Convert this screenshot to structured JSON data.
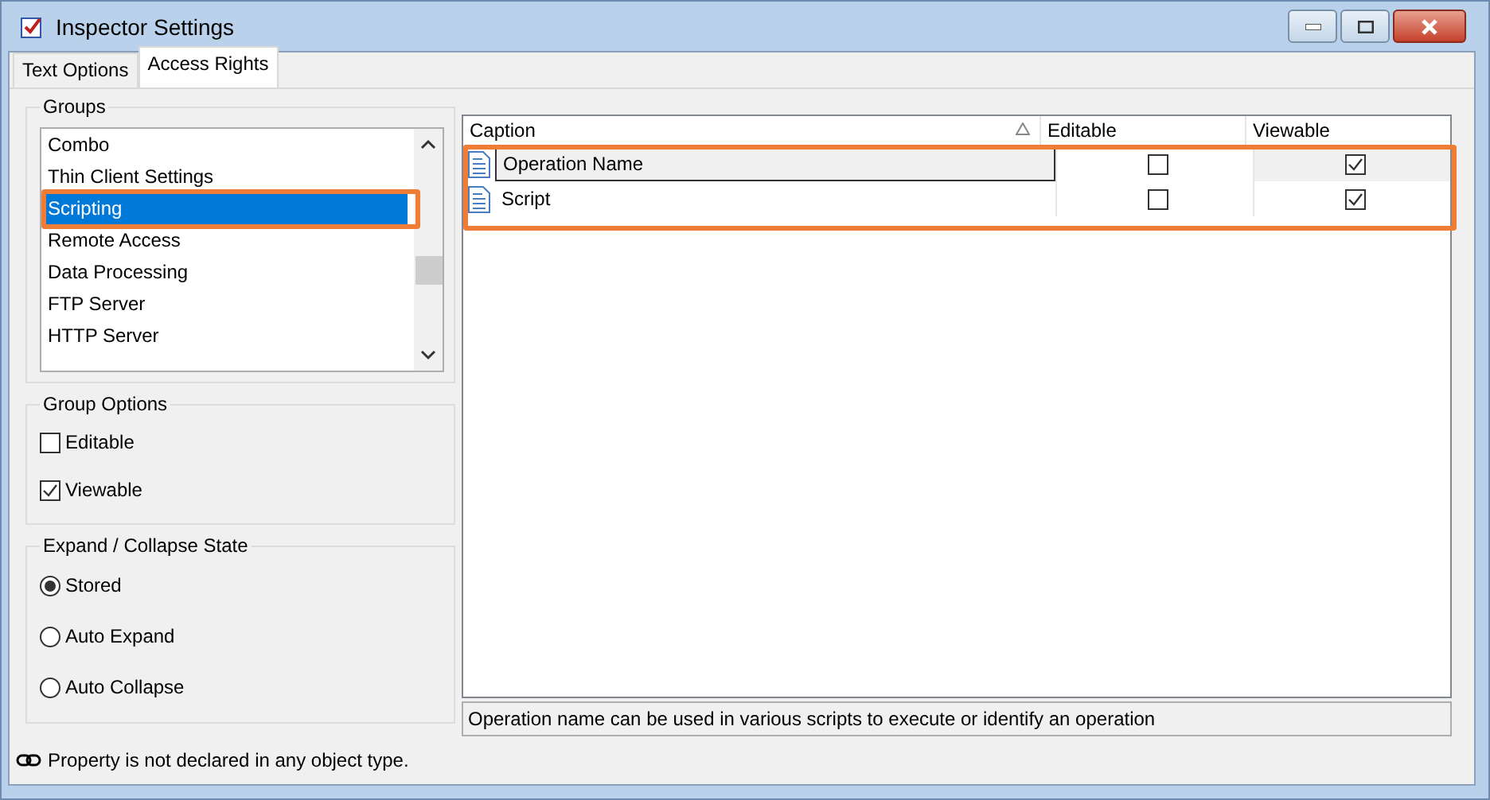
{
  "window": {
    "title": "Inspector Settings"
  },
  "tabs": [
    {
      "label": "Text Options",
      "selected": false
    },
    {
      "label": "Access Rights",
      "selected": true
    }
  ],
  "groups": {
    "title": "Groups",
    "items": [
      {
        "label": "Combo",
        "selected": false
      },
      {
        "label": "Thin Client Settings",
        "selected": false
      },
      {
        "label": "Scripting",
        "selected": true
      },
      {
        "label": "Remote Access",
        "selected": false
      },
      {
        "label": "Data Processing",
        "selected": false
      },
      {
        "label": "FTP Server",
        "selected": false
      },
      {
        "label": "HTTP Server",
        "selected": false
      }
    ]
  },
  "group_options": {
    "title": "Group Options",
    "items": [
      {
        "label": "Editable",
        "checked": false
      },
      {
        "label": "Viewable",
        "checked": true
      }
    ]
  },
  "expand_state": {
    "title": "Expand / Collapse State",
    "items": [
      {
        "label": "Stored",
        "selected": true
      },
      {
        "label": "Auto Expand",
        "selected": false
      },
      {
        "label": "Auto Collapse",
        "selected": false
      }
    ]
  },
  "table": {
    "columns": [
      "Caption",
      "Editable",
      "Viewable"
    ],
    "rows": [
      {
        "caption": "Operation Name",
        "editable": false,
        "viewable": true,
        "selected": true
      },
      {
        "caption": "Script",
        "editable": false,
        "viewable": true,
        "selected": false
      }
    ]
  },
  "description": "Operation name can be used in various scripts to execute or identify an operation",
  "status_bar": "Property is not declared in any object type."
}
